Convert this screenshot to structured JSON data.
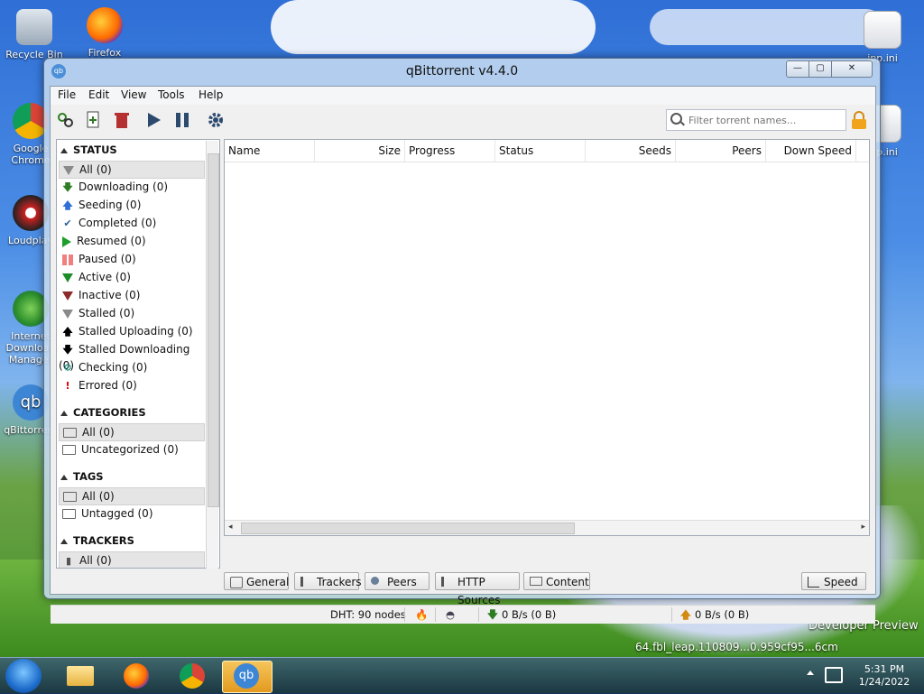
{
  "desktop": {
    "icons": [
      {
        "label": "Recycle Bin"
      },
      {
        "label": "Firefox"
      },
      {
        "label": "Google Chrome"
      },
      {
        "label": "Loudplay"
      },
      {
        "label": "Internet Download Manager"
      },
      {
        "label": "qBittorrent"
      },
      {
        "label": "ipp.ini"
      },
      {
        "label": "ipp.ini"
      }
    ],
    "watermark_line1": "Developer Preview",
    "watermark_line2": "64.fbl_leap.110809...0.959cf95...6cm"
  },
  "window": {
    "title": "qBittorrent v4.4.0",
    "buttons": {
      "minimize": "—",
      "maximize": "▢",
      "close": "✕"
    }
  },
  "menu": [
    "File",
    "Edit",
    "View",
    "Tools",
    "Help"
  ],
  "toolbar": {
    "search_placeholder": "Filter torrent names...",
    "icons": [
      "add-link-icon",
      "add-torrent-icon",
      "delete-icon",
      "resume-icon",
      "pause-icon",
      "options-gear-icon"
    ]
  },
  "sidebar": {
    "status_header": "STATUS",
    "status_items": [
      {
        "label": "All (0)",
        "icon": "funnel-grey",
        "selected": true
      },
      {
        "label": "Downloading (0)",
        "icon": "down"
      },
      {
        "label": "Seeding (0)",
        "icon": "up"
      },
      {
        "label": "Completed (0)",
        "icon": "check"
      },
      {
        "label": "Resumed (0)",
        "icon": "play"
      },
      {
        "label": "Paused (0)",
        "icon": "pause"
      },
      {
        "label": "Active (0)",
        "icon": "funnel-green"
      },
      {
        "label": "Inactive (0)",
        "icon": "funnel-red"
      },
      {
        "label": "Stalled (0)",
        "icon": "funnel-grey"
      },
      {
        "label": "Stalled Uploading (0)",
        "icon": "blackup"
      },
      {
        "label": "Stalled Downloading (0)",
        "icon": "blackdown"
      },
      {
        "label": "Checking (0)",
        "icon": "gear"
      },
      {
        "label": "Errored (0)",
        "icon": "err"
      }
    ],
    "categories_header": "CATEGORIES",
    "categories_items": [
      {
        "label": "All (0)",
        "selected": true
      },
      {
        "label": "Uncategorized (0)"
      }
    ],
    "tags_header": "TAGS",
    "tags_items": [
      {
        "label": "All (0)",
        "selected": true
      },
      {
        "label": "Untagged (0)"
      }
    ],
    "trackers_header": "TRACKERS",
    "trackers_items": [
      {
        "label": "All (0)",
        "selected": true
      }
    ]
  },
  "table": {
    "columns": [
      "Name",
      "Size",
      "Progress",
      "Status",
      "Seeds",
      "Peers",
      "Down Speed"
    ],
    "rows": []
  },
  "tabs": [
    "General",
    "Trackers",
    "Peers",
    "HTTP Sources",
    "Content",
    "Speed"
  ],
  "statusbar": {
    "dht": "DHT: 90 nodes",
    "down": "0 B/s (0 B)",
    "up": "0 B/s (0 B)"
  },
  "taskbar": {
    "time": "5:31 PM",
    "date": "1/24/2022"
  }
}
